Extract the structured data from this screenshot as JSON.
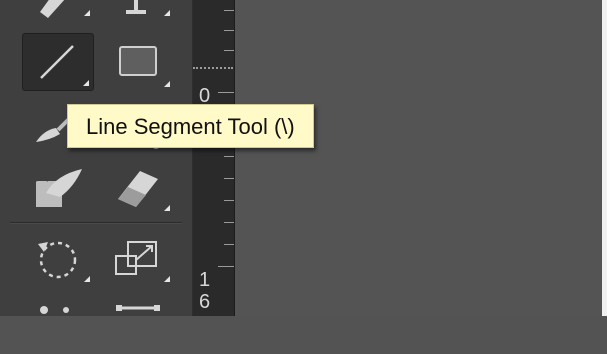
{
  "tooltip": {
    "text": "Line Segment Tool (\\)"
  },
  "tools": [
    {
      "name": "pen-tool",
      "icon": "pen-icon"
    },
    {
      "name": "type-tool",
      "icon": "type-icon"
    },
    {
      "name": "line-segment-tool",
      "icon": "line-segment-icon",
      "selected": true
    },
    {
      "name": "rectangle-tool",
      "icon": "rectangle-icon"
    },
    {
      "name": "paintbrush-tool",
      "icon": "paintbrush-icon"
    },
    {
      "name": "shaper-tool",
      "icon": "shaper-icon"
    },
    {
      "name": "blob-brush-tool",
      "icon": "blob-brush-icon"
    },
    {
      "name": "eraser-tool",
      "icon": "eraser-icon"
    },
    {
      "name": "rotate-tool",
      "icon": "rotate-icon"
    },
    {
      "name": "scale-tool",
      "icon": "scale-icon"
    },
    {
      "name": "width-tool",
      "icon": "width-icon"
    },
    {
      "name": "free-transform-tool",
      "icon": "free-transform-icon"
    }
  ],
  "ruler": {
    "labels": [
      "0",
      "1",
      "6"
    ]
  },
  "colors": {
    "toolbar_bg": "#3f3f3f",
    "canvas_bg": "#545454",
    "ruler_bg": "#2a2a2a",
    "tooltip_bg": "#fffac8",
    "icon": "#d6d6d6"
  }
}
